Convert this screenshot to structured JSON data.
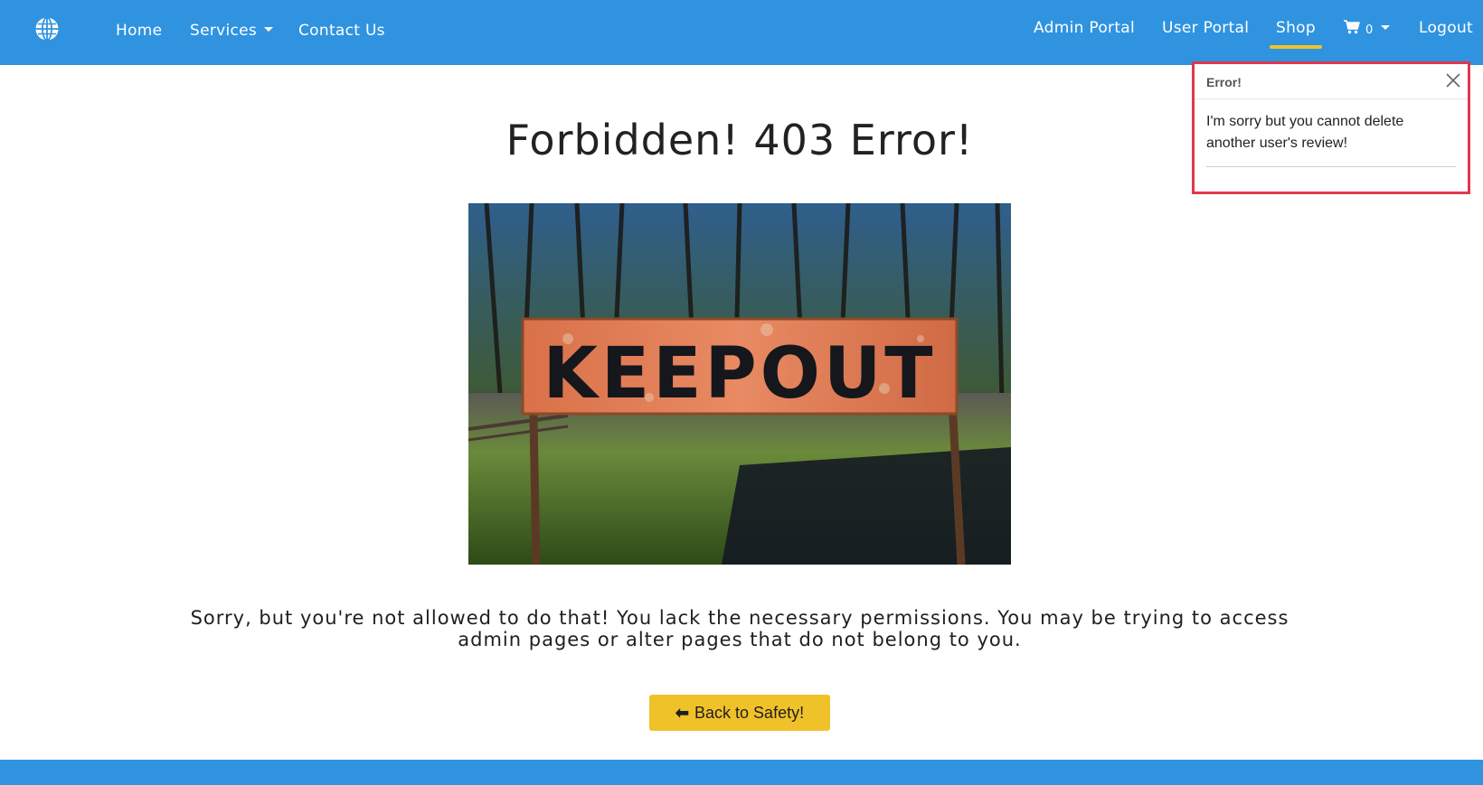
{
  "navbar": {
    "logo_icon": "globe-icon",
    "left_links": [
      "Home",
      "Services",
      "Contact Us"
    ],
    "right_links": {
      "admin_portal": "Admin Portal",
      "user_portal": "User Portal",
      "shop": "Shop",
      "cart_icon": "cart-icon",
      "cart_count": "0",
      "logout": "Logout"
    },
    "colors": {
      "bar": "#2f93e0",
      "active_underline": "#f0c22a"
    }
  },
  "main": {
    "title": "Forbidden! 403 Error!",
    "image_sign_text": "KEEPOUT",
    "message": "Sorry, but you're not allowed to do that! You lack the necessary permissions. You may be trying to access admin pages or alter pages that do not belong to you.",
    "back_button": {
      "icon": "arrow-left-icon",
      "label": "Back to Safety!"
    }
  },
  "toast": {
    "title": "Error!",
    "body": "I'm sorry but you cannot delete another user's review!",
    "close_icon": "close-icon",
    "border_color": "#e0384d"
  }
}
